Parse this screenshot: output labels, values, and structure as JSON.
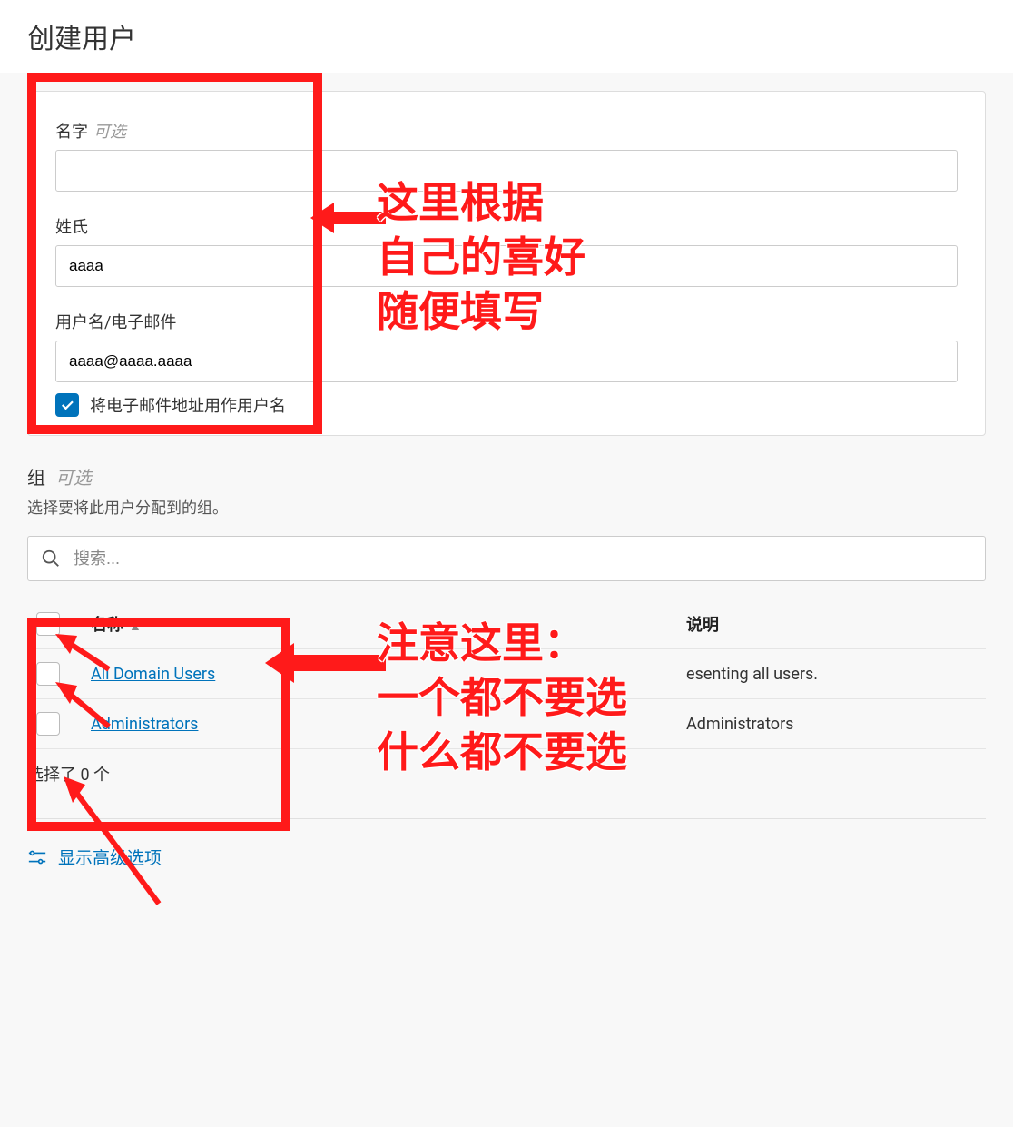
{
  "header": {
    "title": "创建用户"
  },
  "form": {
    "firstName": {
      "label": "名字",
      "optional": "可选",
      "value": ""
    },
    "lastName": {
      "label": "姓氏",
      "value": "aaaa"
    },
    "username": {
      "label": "用户名/电子邮件",
      "value": "aaaa@aaaa.aaaa"
    },
    "emailCheckbox": {
      "label": "将电子邮件地址用作用户名",
      "checked": true
    }
  },
  "groups": {
    "title": "组",
    "optional": "可选",
    "desc": "选择要将此用户分配到的组。",
    "searchPlaceholder": "搜索...",
    "columns": {
      "name": "名称",
      "desc": "说明"
    },
    "rows": [
      {
        "name": "All Domain Users",
        "desc": "esenting all users."
      },
      {
        "name": "Administrators",
        "desc": "Administrators"
      }
    ],
    "selectedText": "选择了 0 个"
  },
  "advanced": {
    "label": "显示高级选项"
  },
  "annotations": {
    "a1": "这里根据\n自己的喜好\n随便填写",
    "a2": "注意这里：\n一个都不要选\n什么都不要选"
  }
}
